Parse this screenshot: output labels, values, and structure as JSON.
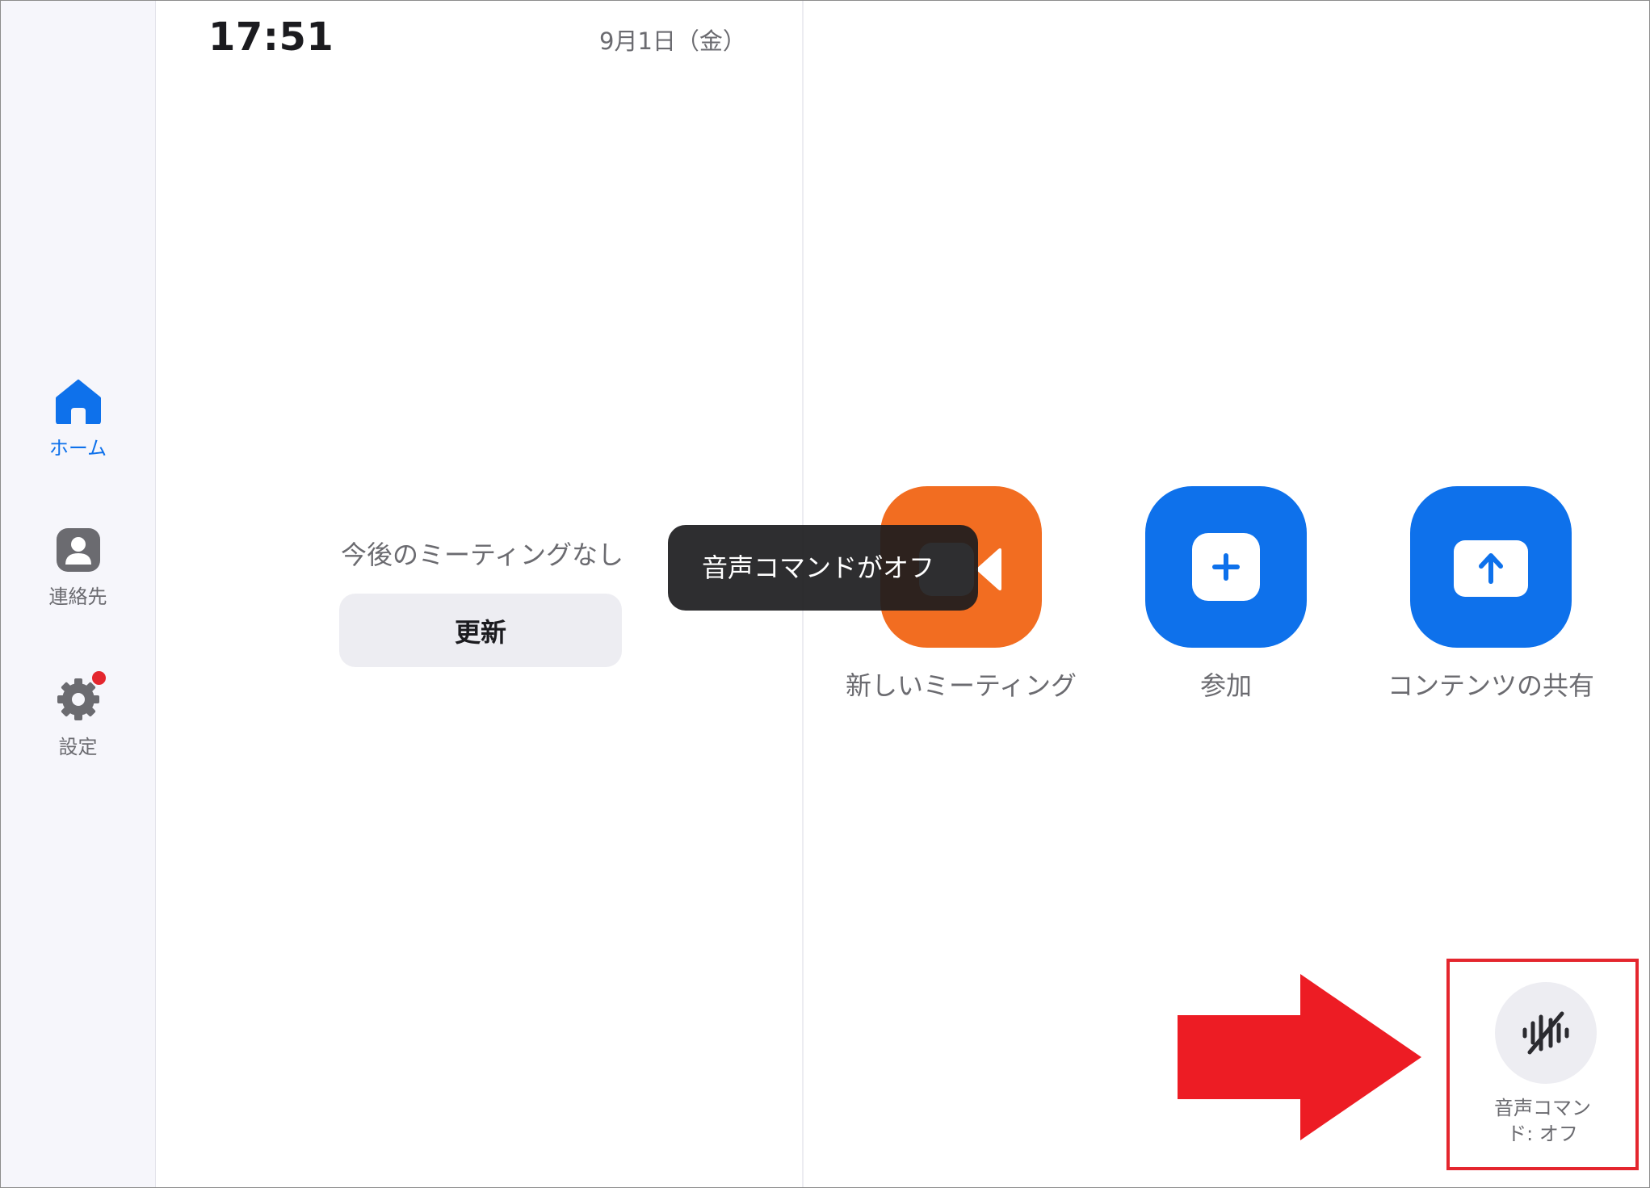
{
  "sidebar": {
    "items": [
      {
        "label": "ホーム",
        "icon": "home-icon",
        "active": true
      },
      {
        "label": "連絡先",
        "icon": "contact-icon",
        "active": false
      },
      {
        "label": "設定",
        "icon": "gear-icon",
        "active": false,
        "badge": true
      }
    ]
  },
  "header": {
    "time": "17:51",
    "date": "9月1日（金）"
  },
  "schedule": {
    "empty_text": "今後のミーティングなし",
    "refresh_label": "更新"
  },
  "actions": [
    {
      "label": "新しいミーティング",
      "icon": "video-camera-icon",
      "color": "#F26D21"
    },
    {
      "label": "参加",
      "icon": "plus-icon",
      "color": "#0E71EB"
    },
    {
      "label": "コンテンツの共有",
      "icon": "share-upload-icon",
      "color": "#0E71EB"
    }
  ],
  "tooltip": {
    "text": "音声コマンドがオフ"
  },
  "voice_command": {
    "label_line1": "音声コマン",
    "label_line2": "ド: オフ",
    "icon": "voice-off-icon"
  },
  "annotation": {
    "arrow_color": "#ED1C24",
    "highlight_color": "#E4262E"
  }
}
